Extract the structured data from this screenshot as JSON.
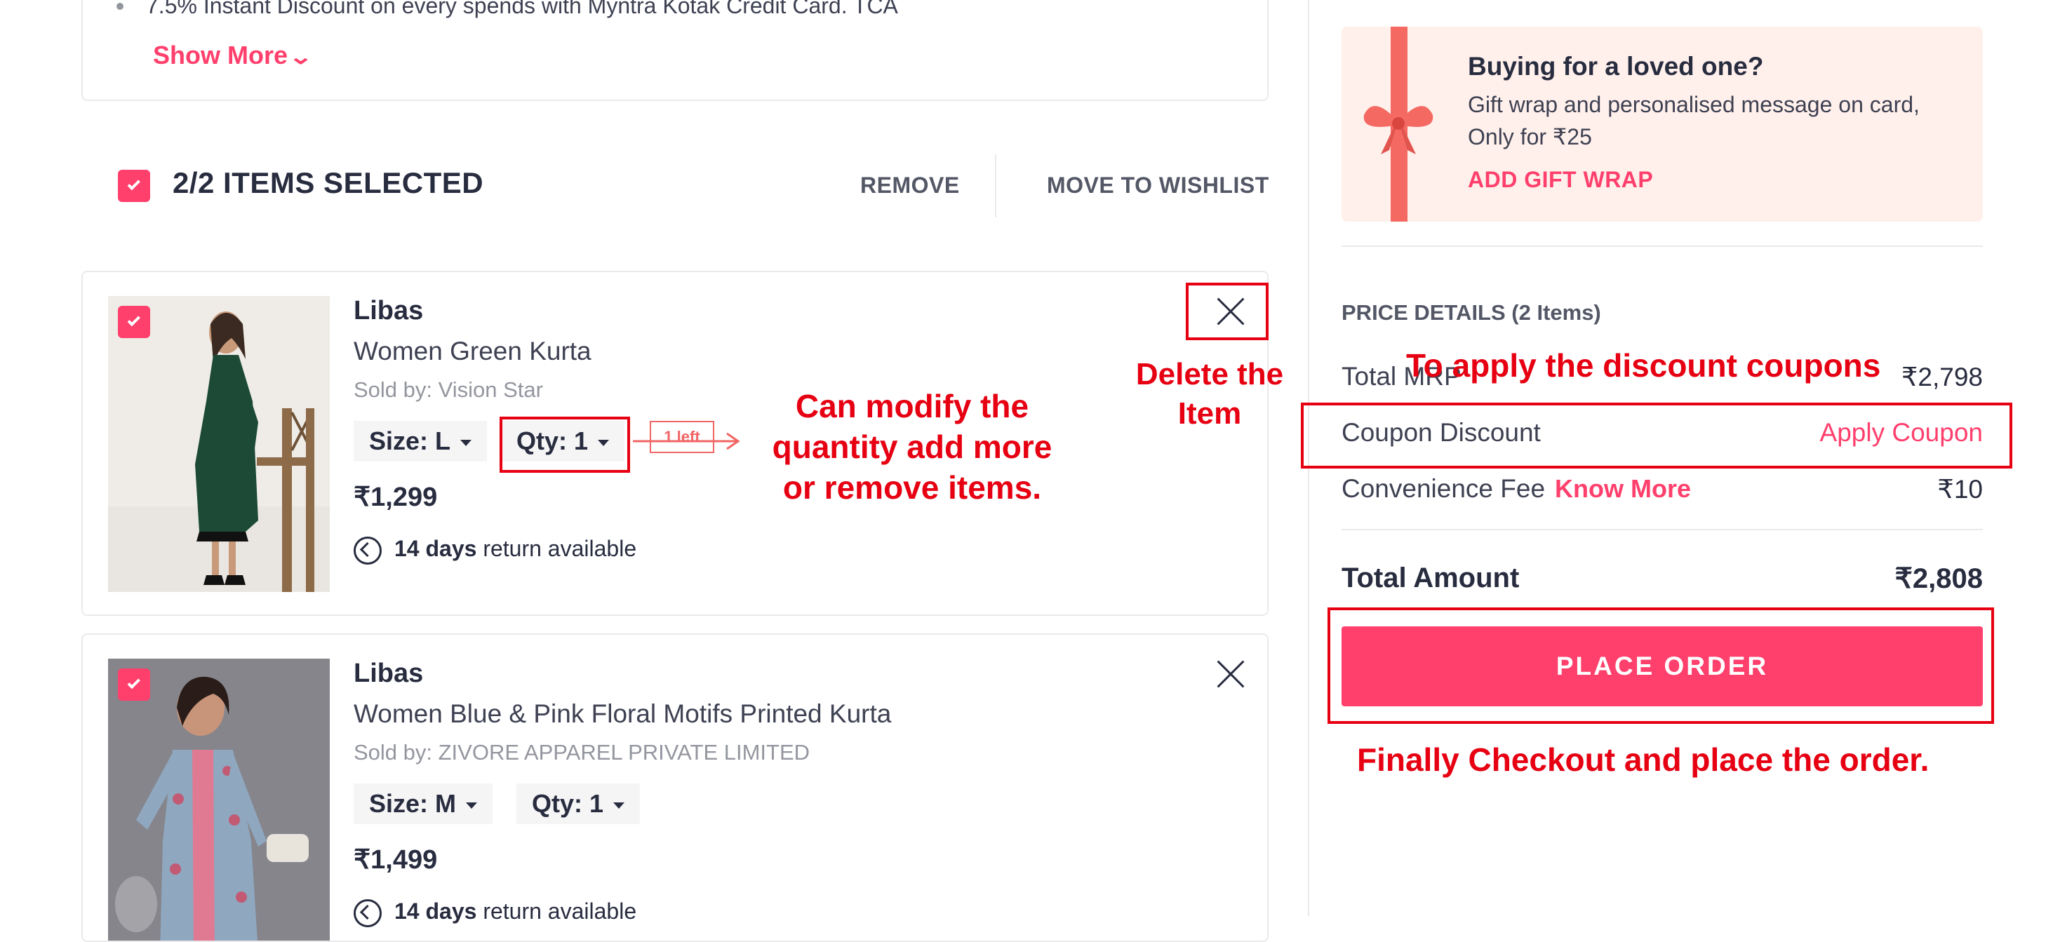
{
  "offers": {
    "line": "7.5% Instant Discount on every spends with Myntra Kotak Credit Card. TCA",
    "show_more": "Show More"
  },
  "selection": {
    "text": "2/2 ITEMS SELECTED",
    "remove": "REMOVE",
    "move_to_wishlist": "MOVE TO WISHLIST"
  },
  "items": [
    {
      "brand": "Libas",
      "name": "Women Green Kurta",
      "seller": "Sold by: Vision Star",
      "size": "Size: L",
      "qty": "Qty: 1",
      "left_tag": "1 left",
      "price": "₹1,299",
      "return_days": "14 days",
      "return_text": "return available",
      "image_colors": [
        "#e4e1dc",
        "#1d4d3a"
      ]
    },
    {
      "brand": "Libas",
      "name": "Women Blue & Pink Floral Motifs Printed Kurta",
      "seller": "Sold by: ZIVORE APPAREL PRIVATE LIMITED",
      "size": "Size: M",
      "qty": "Qty: 1",
      "price": "₹1,499",
      "return_days": "14 days",
      "return_text": "return available",
      "image_colors": [
        "#7a7a80",
        "#c25a74"
      ]
    }
  ],
  "gift": {
    "title": "Buying for a loved one?",
    "text": "Gift wrap and personalised message on card, Only for ₹25",
    "link": "ADD GIFT WRAP"
  },
  "price_details": {
    "title": "PRICE DETAILS (2 Items)",
    "total_mrp_label": "Total MRP",
    "total_mrp_value": "₹2,798",
    "coupon_label": "Coupon Discount",
    "coupon_action": "Apply Coupon",
    "fee_label": "Convenience Fee",
    "fee_link": "Know More",
    "fee_value": "₹10",
    "total_label": "Total Amount",
    "total_value": "₹2,808",
    "place_order": "PLACE ORDER"
  },
  "annotations": {
    "delete": [
      "Delete the",
      "Item"
    ],
    "quantity": [
      "Can modify the",
      "quantity add more",
      "or remove items."
    ],
    "coupons": "To apply the discount coupons",
    "checkout": "Finally Checkout and place the order."
  },
  "colors": {
    "brand_pink": "#ff3f6c",
    "annotation_red": "#e60012",
    "gift_bg": "#fff0ec"
  }
}
